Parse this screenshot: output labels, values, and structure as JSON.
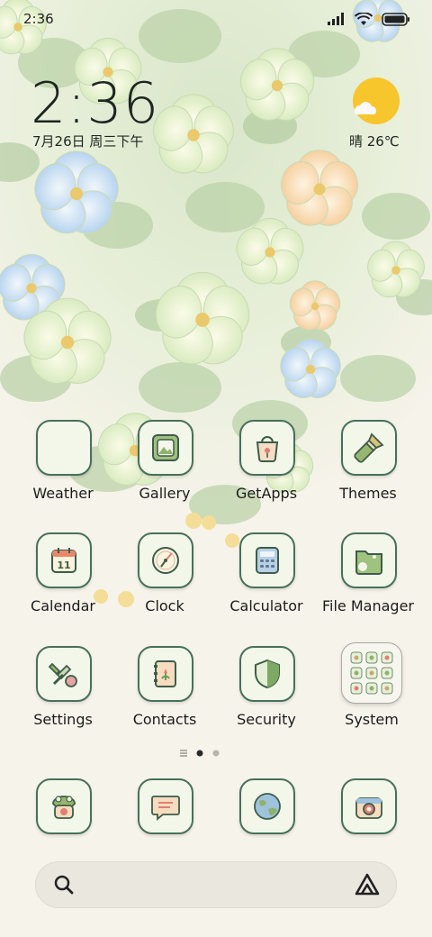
{
  "status_bar": {
    "time": "2:36",
    "icons": [
      "signal-icon",
      "wifi-icon",
      "battery-icon"
    ]
  },
  "clock_widget": {
    "time": "2:36",
    "date": "7月26日 周三下午"
  },
  "weather_widget": {
    "text": "晴 26℃",
    "icon": "sun-cloud-icon"
  },
  "apps_row1": [
    {
      "label": "Weather",
      "icon": "weather-icon"
    },
    {
      "label": "Gallery",
      "icon": "gallery-icon"
    },
    {
      "label": "GetApps",
      "icon": "getapps-bag-icon"
    },
    {
      "label": "Themes",
      "icon": "paintbrush-icon"
    }
  ],
  "apps_row2": [
    {
      "label": "Calendar",
      "icon": "calendar-icon",
      "badge": "11"
    },
    {
      "label": "Clock",
      "icon": "clock-icon"
    },
    {
      "label": "Calculator",
      "icon": "calculator-icon"
    },
    {
      "label": "File Manager",
      "icon": "folder-icon"
    }
  ],
  "apps_row3": [
    {
      "label": "Settings",
      "icon": "wrench-icon"
    },
    {
      "label": "Contacts",
      "icon": "contacts-book-icon"
    },
    {
      "label": "Security",
      "icon": "shield-icon"
    },
    {
      "label": "System",
      "icon": "folder-grid-icon"
    }
  ],
  "dock": [
    {
      "icon": "phone-icon"
    },
    {
      "icon": "messages-icon"
    },
    {
      "icon": "browser-globe-icon"
    },
    {
      "icon": "camera-icon"
    }
  ],
  "pager": {
    "pages": 2,
    "current": 1
  },
  "search_bar": {
    "left_icon": "search-icon",
    "right_icon": "assistant-icon"
  },
  "colors": {
    "tile_border": "#48705a",
    "tile_bg": "#f2f7ea",
    "background": "#f6f3ea",
    "sun": "#f7c52c"
  }
}
